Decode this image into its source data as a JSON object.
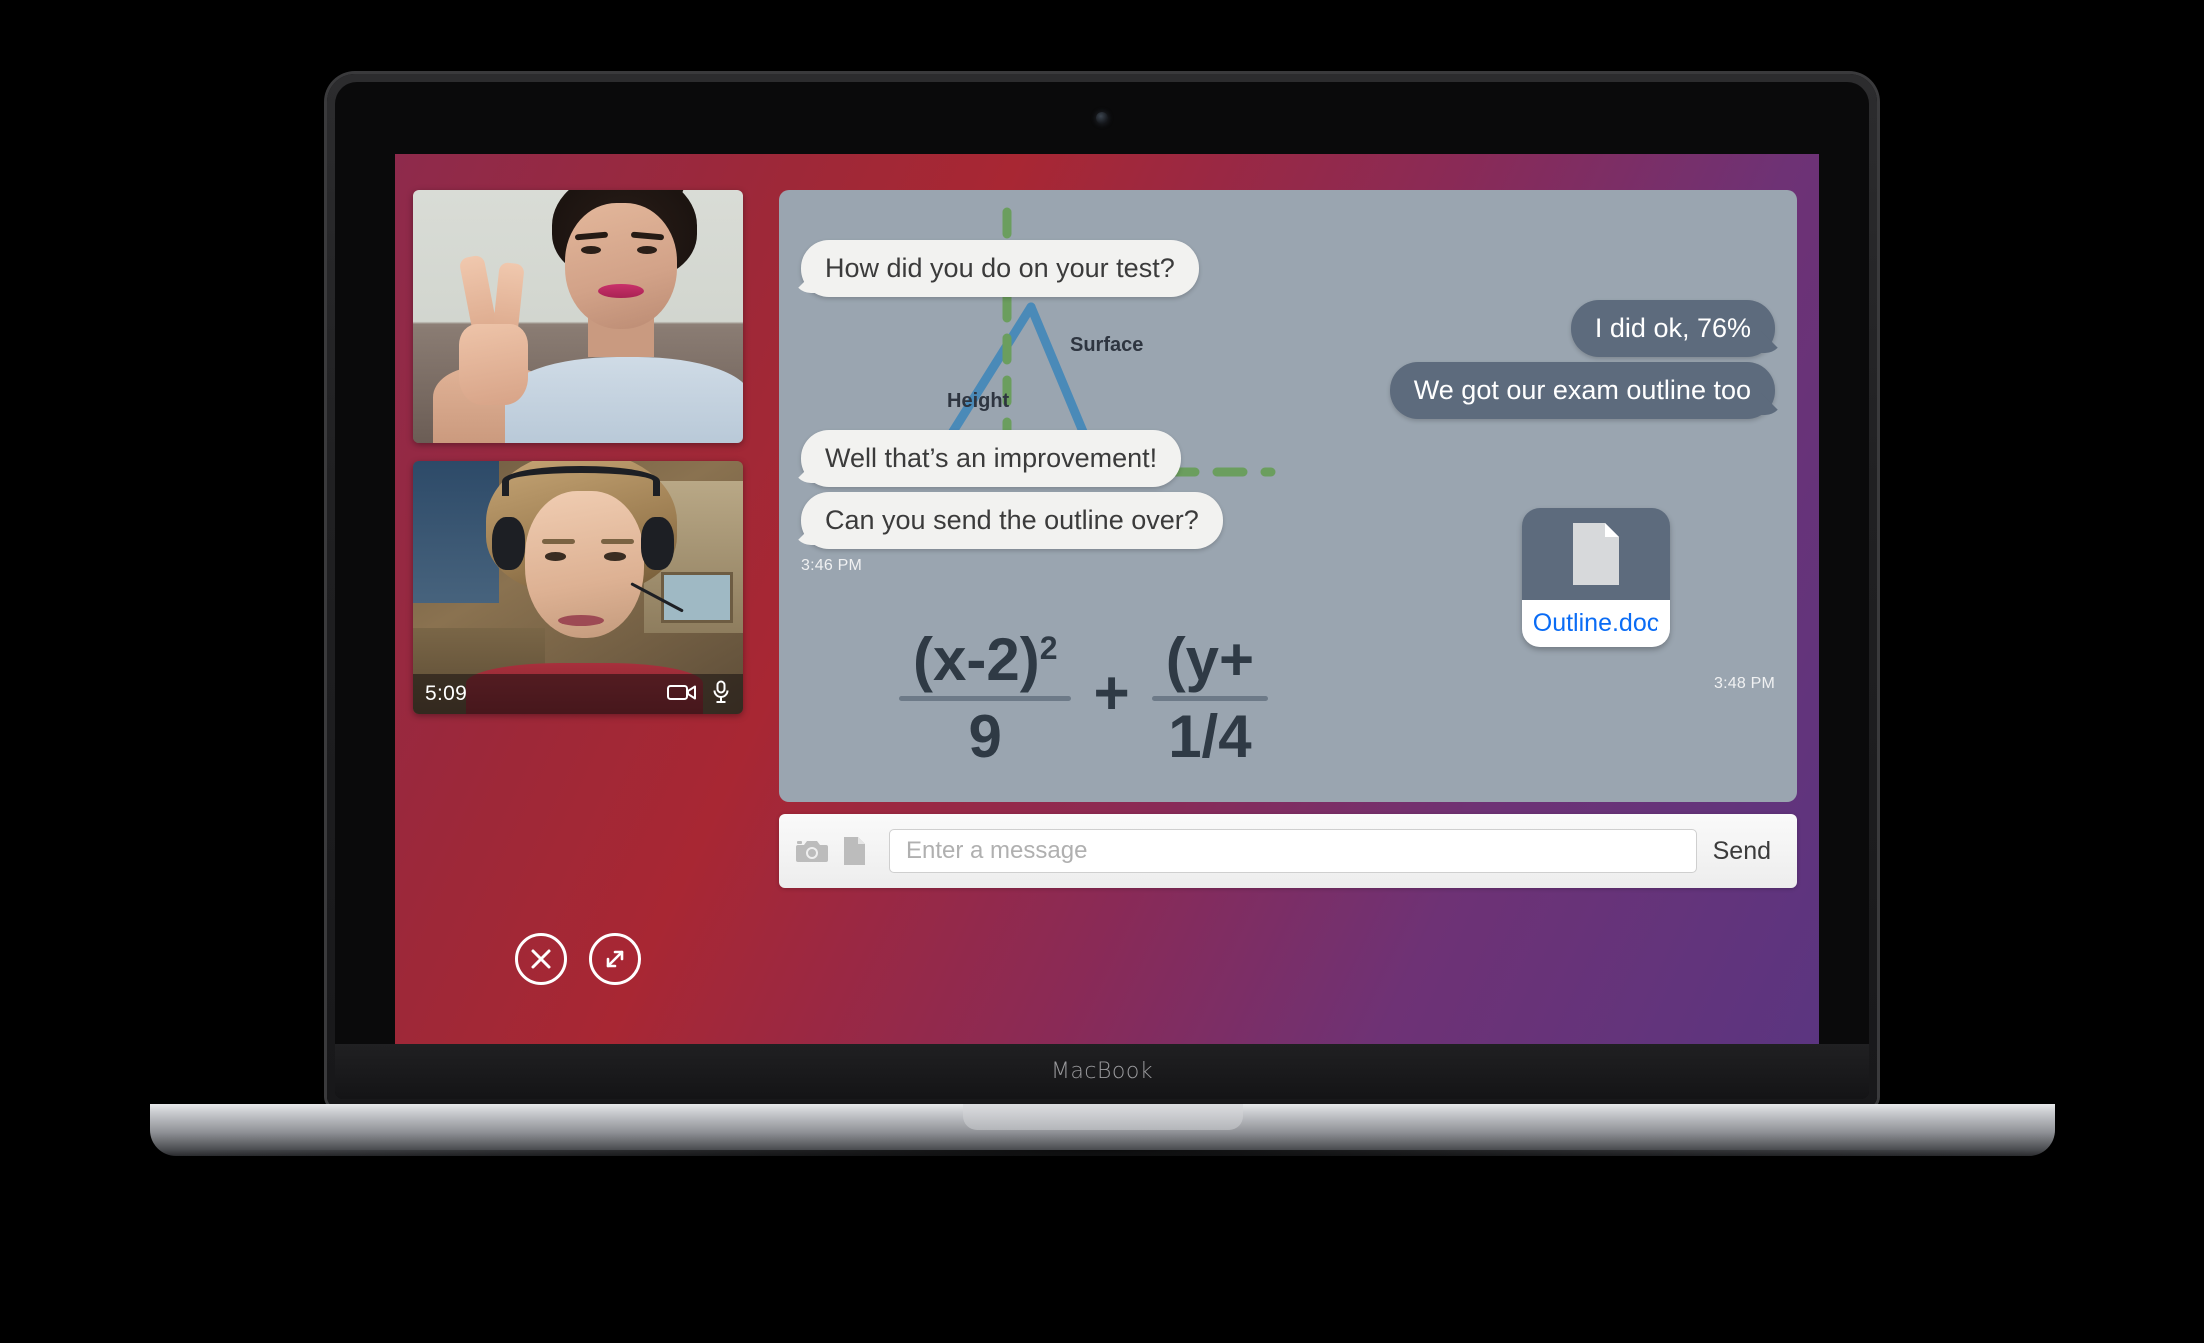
{
  "device": {
    "brand_label": "MacBook"
  },
  "call": {
    "duration": "5:09",
    "video_icon": "video-camera-icon",
    "mic_icon": "microphone-icon",
    "end_call_icon": "close-x-icon",
    "expand_icon": "expand-arrows-icon"
  },
  "participants": [
    {
      "name": "participant-1-video"
    },
    {
      "name": "participant-2-video"
    }
  ],
  "chat": {
    "messages": [
      {
        "id": "m1",
        "side": "in",
        "text": "How did you do on your test?"
      },
      {
        "id": "m2",
        "side": "out",
        "text": "I did ok, 76%"
      },
      {
        "id": "m3",
        "side": "out",
        "text": "We got our exam outline too"
      },
      {
        "id": "m4",
        "side": "in",
        "text": "Well that’s an improvement!"
      },
      {
        "id": "m5",
        "side": "in",
        "text": "Can you send the outline over?"
      }
    ],
    "timestamp_1": "3:46 PM",
    "timestamp_2": "3:48 PM",
    "attachment": {
      "filename": "Outline.doc",
      "icon": "document-icon"
    },
    "diagram": {
      "label_height": "Height",
      "label_surface": "Surface",
      "triangle_color": "#4a8ab8",
      "dash_color": "#6b9e5e"
    },
    "equation": {
      "left_numerator": "(x-2)",
      "left_exponent": "2",
      "left_denominator": "9",
      "operator": "+",
      "right_numerator": "(y+",
      "right_denominator": "1/4"
    }
  },
  "composer": {
    "camera_icon": "camera-icon",
    "attach_icon": "document-icon",
    "input_value": "",
    "placeholder": "Enter a message",
    "send_label": "Send"
  },
  "colors": {
    "gradient_start": "#8e2a4c",
    "gradient_mid": "#a82733",
    "gradient_end": "#5b3580",
    "chat_bg": "#9aa5b0",
    "bubble_out": "#5d6b7d",
    "bubble_in": "#f2f2f0",
    "link_blue": "#0a6cf5"
  }
}
